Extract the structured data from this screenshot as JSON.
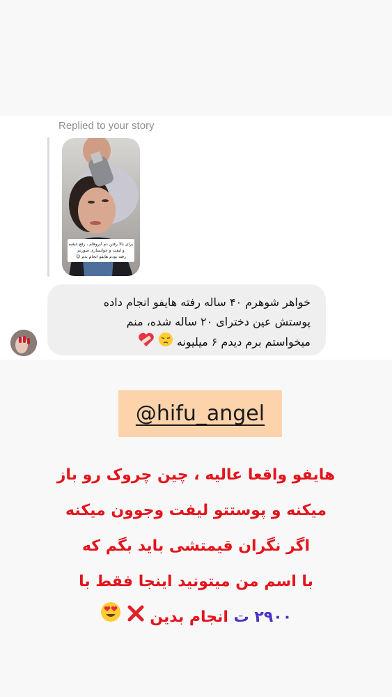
{
  "reply_header": {
    "label": "Replied to your story"
  },
  "story_preview": {
    "caption_lines": [
      "برای بالا رفتن دم ابروهام ، رفع غبغبم",
      "و لیفت و جوانسازی صورتم",
      "رفته بودم هایفو انجام بدم 😉"
    ]
  },
  "message": {
    "lines": [
      "خواهر شوهرم ۴۰ ساله رفته هایفو انجام داده",
      "پوستش عین دخترای ۲۰ ساله شده، منم",
      "میخواستم برم دیدم ۶ میلیونه"
    ],
    "emojis": [
      "pensive-face",
      "heart-with-bandage"
    ]
  },
  "account": {
    "handle": "@hifu_angel",
    "highlight_color": "#fcd3aa"
  },
  "promo": {
    "color": "#e3141c",
    "lines": [
      "هایفو واقعا عالیه ، چین چروک رو باز",
      "میکنه و پوستتو لیفت وجوون میکنه",
      "اگر نگران قیمتشی باید بگم که",
      "با اسم من میتونید اینجا فقط با"
    ],
    "price": "۲۹۰۰ ت",
    "price_color": "#4b32c8",
    "final_text": "انجام بدین",
    "final_emojis": [
      "cross-mark",
      "heart-eyes-face"
    ]
  }
}
